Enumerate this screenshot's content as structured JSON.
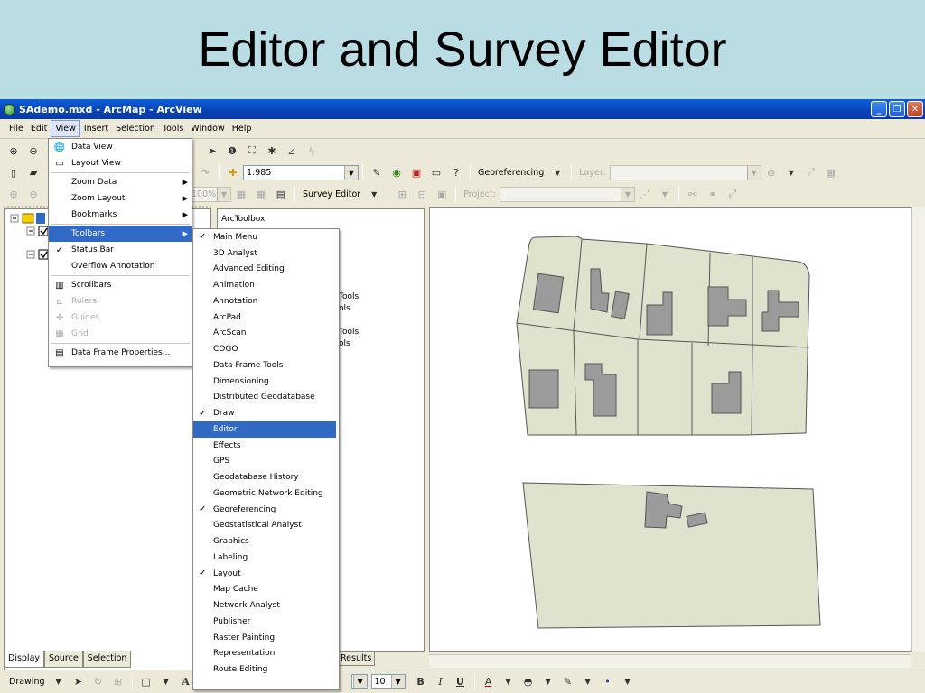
{
  "slide": {
    "title": "Editor and Survey Editor"
  },
  "window": {
    "title": "SAdemo.mxd - ArcMap - ArcView"
  },
  "menubar": {
    "items": [
      "File",
      "Edit",
      "View",
      "Insert",
      "Selection",
      "Tools",
      "Window",
      "Help"
    ]
  },
  "toolbar": {
    "scale_value": "1:985",
    "georeferencing_label": "Georeferencing",
    "layer_label": "Layer:",
    "zoom_value": "100%",
    "survey_editor_label": "Survey Editor",
    "project_label": "Project:"
  },
  "view_menu": {
    "items": [
      {
        "label": "Data View",
        "icon": "globe-icon"
      },
      {
        "label": "Layout View",
        "icon": "layout-icon"
      },
      {
        "label": "Zoom Data",
        "submenu": true
      },
      {
        "label": "Zoom Layout",
        "submenu": true
      },
      {
        "label": "Bookmarks",
        "submenu": true
      },
      {
        "label": "Toolbars",
        "submenu": true,
        "highlighted": true
      },
      {
        "label": "Status Bar",
        "checked": true
      },
      {
        "label": "Overflow Annotation"
      },
      {
        "label": "Scrollbars",
        "icon": "scrollbars-icon"
      },
      {
        "label": "Rulers",
        "icon": "rulers-icon",
        "disabled": true
      },
      {
        "label": "Guides",
        "icon": "guides-icon",
        "disabled": true
      },
      {
        "label": "Grid",
        "icon": "grid-icon",
        "disabled": true
      },
      {
        "label": "Data Frame Properties...",
        "icon": "properties-icon"
      }
    ]
  },
  "toolbars_menu": {
    "items": [
      {
        "label": "Main Menu",
        "checked": true
      },
      {
        "label": "3D Analyst"
      },
      {
        "label": "Advanced Editing"
      },
      {
        "label": "Animation"
      },
      {
        "label": "Annotation"
      },
      {
        "label": "ArcPad"
      },
      {
        "label": "ArcScan"
      },
      {
        "label": "COGO"
      },
      {
        "label": "Data Frame Tools"
      },
      {
        "label": "Dimensioning"
      },
      {
        "label": "Distributed Geodatabase"
      },
      {
        "label": "Draw",
        "checked": true
      },
      {
        "label": "Editor",
        "highlighted": true
      },
      {
        "label": "Effects"
      },
      {
        "label": "GPS"
      },
      {
        "label": "Geodatabase History"
      },
      {
        "label": "Geometric Network Editing"
      },
      {
        "label": "Georeferencing",
        "checked": true
      },
      {
        "label": "Geostatistical Analyst"
      },
      {
        "label": "Graphics"
      },
      {
        "label": "Labeling"
      },
      {
        "label": "Layout",
        "checked": true
      },
      {
        "label": "Map Cache"
      },
      {
        "label": "Network Analyst"
      },
      {
        "label": "Publisher"
      },
      {
        "label": "Raster Painting"
      },
      {
        "label": "Representation"
      },
      {
        "label": "Route Editing"
      }
    ]
  },
  "toc": {
    "tabs": [
      "Display",
      "Source",
      "Selection"
    ]
  },
  "toolbox": {
    "header": "ArcToolbox",
    "fragments": [
      "Tools",
      "ols",
      "Tools",
      "ols"
    ],
    "results_tab": "Results"
  },
  "drawing_toolbar": {
    "drawing_label": "Drawing",
    "font_size": "10",
    "bold": "B",
    "italic": "I",
    "underline": "U",
    "font_color_letter": "A"
  },
  "colors": {
    "slide_background": "#b9dde3",
    "parcel_fill": "#dfe2cc",
    "building_fill": "#9b9b9b",
    "menu_highlight": "#316ac5"
  }
}
